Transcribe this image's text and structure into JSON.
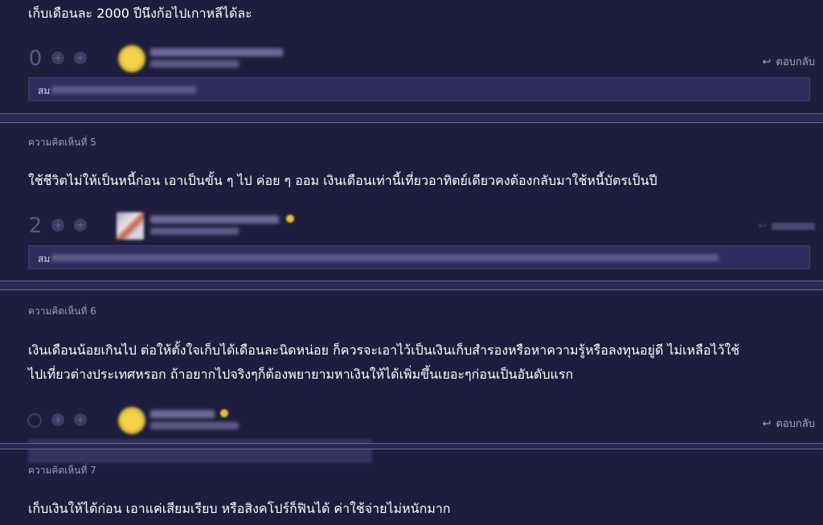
{
  "comments": [
    {
      "text": "เก็บเดือนละ 2000 ปีนึงก้อไปเกาหลีได้ละ",
      "votes": "0",
      "reply_label": "ตอบกลับ",
      "emoji_prefix": "สม"
    },
    {
      "number_label": "ความคิดเห็นที่ 5",
      "text": "ใช้ชีวิตไม่ให้เป็นหนี้ก่อน เอาเป็นขั้น ๆ ไป ค่อย ๆ ออม เงินเดือนเท่านี้เที่ยวอาทิตย์เดียวคงต้องกลับมาใช้หนี้บัตรเป็นปี",
      "votes": "2",
      "emoji_prefix": "สม"
    },
    {
      "number_label": "ความคิดเห็นที่ 6",
      "text_line1": "เงินเดือนน้อยเกินไป ต่อให้ตั้งใจเก็บได้เดือนละนิดหน่อย ก็ควรจะเอาไว้เป็นเงินเก็บสำรองหรือหาความรู้หรือลงทุนอยู่ดี ไม่เหลือไว้ใช้",
      "text_line2": "ไปเที่ยวต่างประเทศหรอก ถ้าอยากไปจริงๆก็ต้องพยายามหาเงินให้ได้เพิ่มขึ้นเยอะๆก่อนเป็นอันดับแรก",
      "reply_label": "ตอบกลับ"
    },
    {
      "number_label": "ความคิดเห็นที่ 7",
      "text": "เก็บเงินให้ได้ก่อน เอาแค่เสียมเรียบ หรือสิงคโปร์ก็ฟินได้ ค่าใช้จ่ายไม่หนักมาก"
    }
  ],
  "colors": {
    "background": "#1f1d3d",
    "divider": "#2a2850",
    "text": "#ffffff",
    "muted": "#9e9cbc"
  },
  "icons": {
    "plus": "plus-icon",
    "reply": "reply-arrow-icon",
    "badge": "star-badge-icon"
  }
}
